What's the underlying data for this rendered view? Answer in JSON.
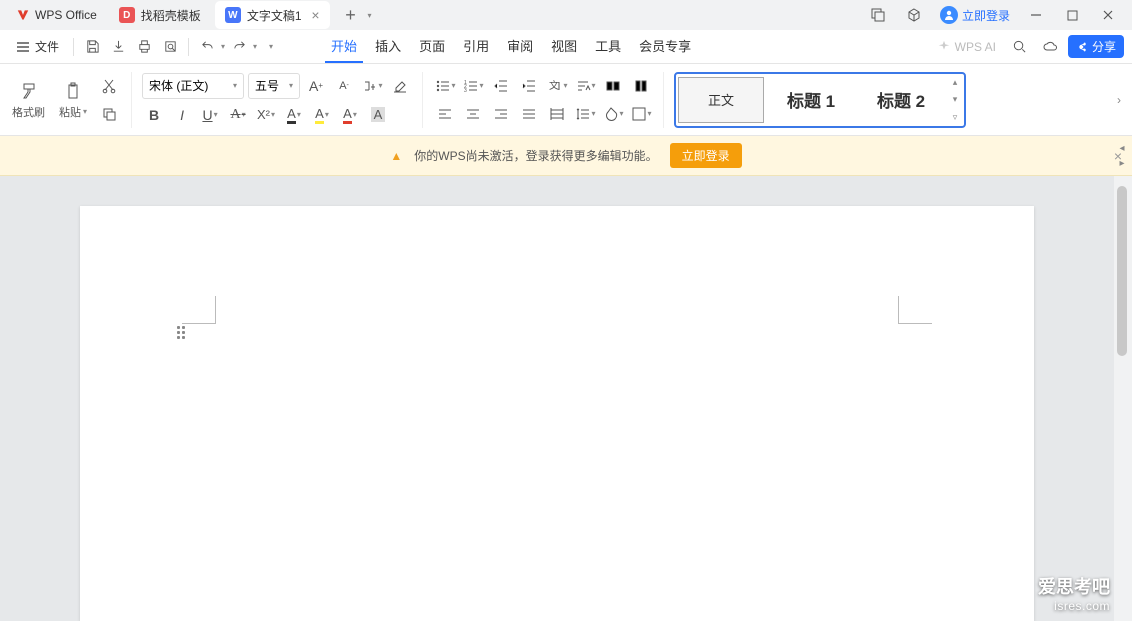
{
  "app": {
    "name": "WPS Office"
  },
  "tabs": {
    "template": {
      "label": "找稻壳模板"
    },
    "doc": {
      "label": "文字文稿1"
    }
  },
  "login_text": "立即登录",
  "file_menu": "文件",
  "menu": {
    "start": "开始",
    "insert": "插入",
    "layout": "页面",
    "refs": "引用",
    "review": "审阅",
    "view": "视图",
    "tools": "工具",
    "member": "会员专享"
  },
  "ai_label": "WPS AI",
  "share_label": "分享",
  "ribbon": {
    "format_painter": "格式刷",
    "paste": "粘贴",
    "font_name": "宋体 (正文)",
    "font_size": "五号",
    "styles": {
      "body": "正文",
      "h1": "标题 1",
      "h2": "标题 2"
    }
  },
  "banner": {
    "message": "你的WPS尚未激活，登录获得更多编辑功能。",
    "button": "立即登录"
  },
  "watermark": {
    "line1": "爱思考吧",
    "line2": "isres.com"
  }
}
